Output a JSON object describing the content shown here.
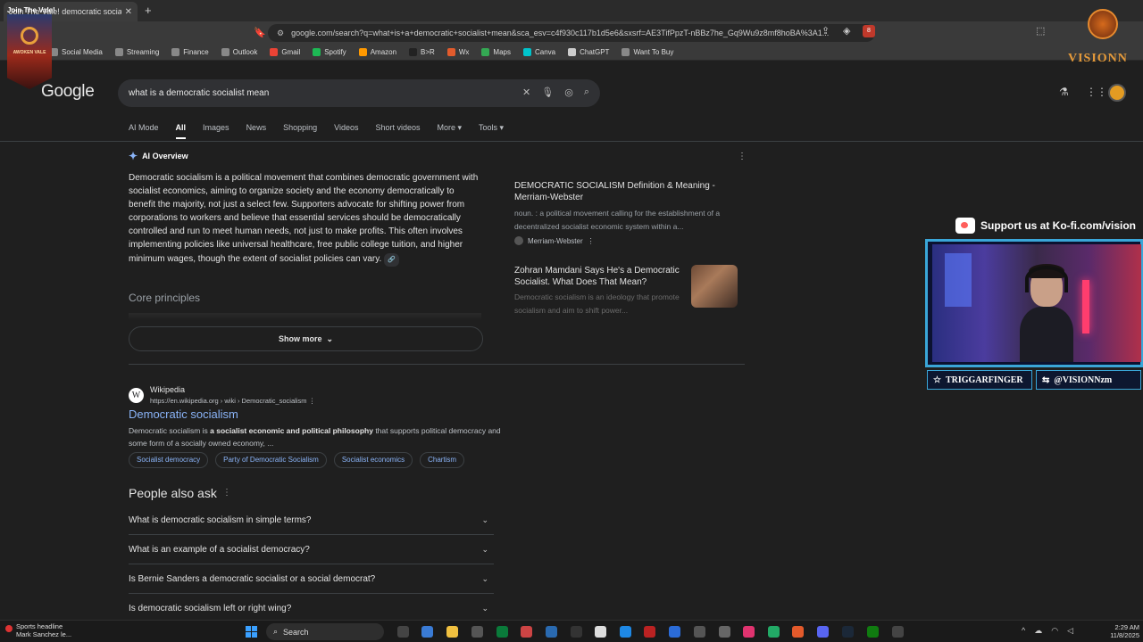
{
  "browser": {
    "tab_title": "Join The Vale! democratic socialist m",
    "url": "google.com/search?q=what+is+a+democratic+socialist+mean&sca_esv=c4f930c117b1d5e6&sxsrf=AE3TifPpzT-nBBz7he_Gq9Wu9z8mf8hoBA%3A1...",
    "ext_badge": "8",
    "bookmarks": [
      {
        "label": "Social Media",
        "color": "#888"
      },
      {
        "label": "Streaming",
        "color": "#888"
      },
      {
        "label": "Finance",
        "color": "#888"
      },
      {
        "label": "Outlook",
        "color": "#888"
      },
      {
        "label": "Gmail",
        "color": "#ea4335"
      },
      {
        "label": "Spotify",
        "color": "#1db954"
      },
      {
        "label": "Amazon",
        "color": "#ff9900"
      },
      {
        "label": "B>R",
        "color": "#222"
      },
      {
        "label": "Wx",
        "color": "#e25b2c"
      },
      {
        "label": "Maps",
        "color": "#34a853"
      },
      {
        "label": "Canva",
        "color": "#00c4cc"
      },
      {
        "label": "ChatGPT",
        "color": "#ccc"
      },
      {
        "label": "Want To Buy",
        "color": "#888"
      }
    ]
  },
  "google": {
    "logo": "Google",
    "query": "what is a democratic socialist mean",
    "tabs": [
      "AI Mode",
      "All",
      "Images",
      "News",
      "Shopping",
      "Videos",
      "Short videos",
      "More ▾",
      "Tools ▾"
    ],
    "ai_overview": {
      "heading": "AI Overview",
      "text": "Democratic socialism is a political movement that combines democratic government with socialist economics, aiming to organize society and the economy democratically to benefit the majority, not just a select few. Supporters advocate for shifting power from corporations to workers and believe that essential services should be democratically controlled and run to meet human needs, not just to make profits. This often involves implementing policies like universal healthcare, free public college tuition, and higher minimum wages, though the extent of socialist policies can vary.",
      "core_principles": "Core principles",
      "show_more": "Show more",
      "sources": [
        {
          "title": "DEMOCRATIC SOCIALISM Definition & Meaning - Merriam-Webster",
          "desc": "noun. : a political movement calling for the establishment of a decentralized socialist economic system within a...",
          "site": "Merriam-Webster"
        },
        {
          "title": "Zohran Mamdani Says He's a Democratic Socialist. What Does That Mean?",
          "desc": "Democratic socialism is an ideology that promote socialism and aim to shift power..."
        }
      ]
    },
    "wiki": {
      "name": "Wikipedia",
      "url": "https://en.wikipedia.org › wiki › Democratic_socialism",
      "title": "Democratic socialism",
      "snippet_a": "Democratic socialism is ",
      "snippet_b": "a socialist economic and political philosophy",
      "snippet_c": " that supports political democracy and some form of a socially owned economy, ...",
      "chips": [
        "Socialist democracy",
        "Party of Democratic Socialism",
        "Socialist economics",
        "Chartism"
      ]
    },
    "paa": {
      "title": "People also ask",
      "questions": [
        "What is democratic socialism in simple terms?",
        "What is an example of a socialist democracy?",
        "Is Bernie Sanders a democratic socialist or a social democrat?",
        "Is democratic socialism left or right wing?"
      ]
    }
  },
  "overlay": {
    "top_text": "Join The Vale!",
    "channel_text": "AWOKEN VALE",
    "vision": "VISIONN",
    "kofi": "Support us at Ko-fi.com/vision",
    "handle1": "TRIGGARFINGER",
    "handle2": "@VISIONNzm"
  },
  "taskbar": {
    "news_title": "Sports headline",
    "news_sub": "Mark Sanchez le...",
    "search": "Search",
    "time": "2:29 AM",
    "date": "11/8/2025"
  }
}
